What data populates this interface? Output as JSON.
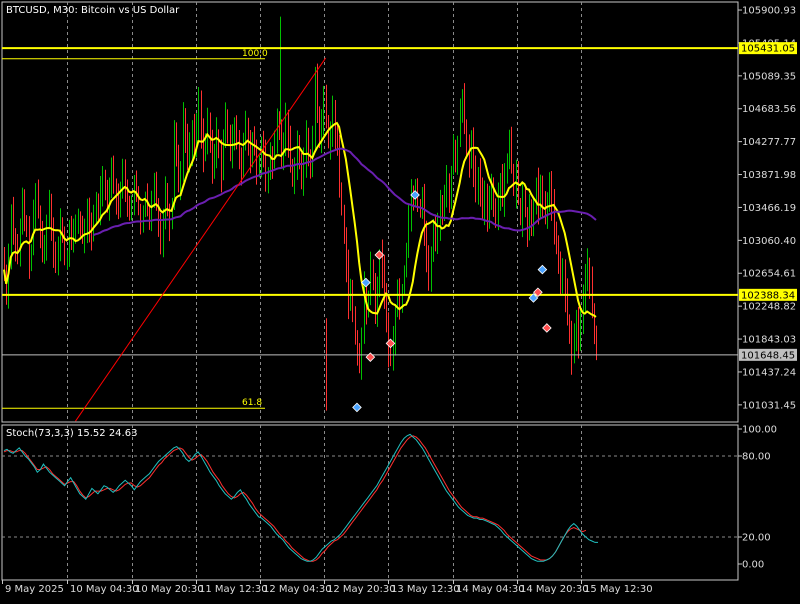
{
  "chart_data": [
    {
      "type": "candlestick",
      "title": "BTCUSD, M30:  Bitcoin vs US Dollar",
      "y_ticks": [
        "105900.93",
        "105495.14",
        "105089.35",
        "104683.56",
        "104277.77",
        "103871.98",
        "103466.19",
        "103060.40",
        "102654.61",
        "102248.82",
        "101843.03",
        "101437.24",
        "101031.45"
      ],
      "ylim": [
        100820,
        106000
      ],
      "x_ticks": [
        "9 May 2025",
        "10 May 04:30",
        "10 May 20:30",
        "11 May 12:30",
        "12 May 04:30",
        "12 May 20:30",
        "13 May 12:30",
        "14 May 04:30",
        "14 May 20:30",
        "15 May 12:30"
      ],
      "horizontal_levels": [
        {
          "label": "105431.05",
          "value": 105431.05,
          "color": "#ffff00"
        },
        {
          "label": "102388.34",
          "value": 102388.34,
          "color": "#ffff00"
        },
        {
          "label": "101648.45",
          "value": 101648.45,
          "color": "#c0c0c0"
        }
      ],
      "fibonacci": {
        "levels": [
          {
            "label": "100.0",
            "value": 105300
          },
          {
            "label": "61.8",
            "value": 100990
          }
        ],
        "color": "#ffff00"
      },
      "trendline": {
        "from": {
          "bar": 32,
          "price": 100830
        },
        "to": {
          "bar": 144,
          "price": 105310
        },
        "color": "#ff0000"
      },
      "candle_colors": {
        "bull": "#00c000",
        "bear": "#ff3030"
      },
      "closes": [
        102700,
        102350,
        102900,
        103450,
        103120,
        102980,
        102820,
        103200,
        103550,
        103300,
        103150,
        102800,
        102950,
        103350,
        103650,
        103420,
        103180,
        102870,
        102990,
        103310,
        103580,
        103260,
        102920,
        102740,
        102960,
        103280,
        103110,
        102810,
        102890,
        103150,
        103040,
        103210,
        103260,
        103330,
        103190,
        103080,
        103240,
        103380,
        103230,
        103090,
        103360,
        103560,
        103420,
        103690,
        103890,
        103660,
        103520,
        103780,
        103960,
        103760,
        103560,
        103410,
        103740,
        103900,
        103730,
        103540,
        103350,
        103560,
        103730,
        103600,
        103420,
        103260,
        103440,
        103580,
        103420,
        103230,
        103520,
        103780,
        103540,
        103280,
        103060,
        103350,
        103680,
        103460,
        103250,
        103530,
        104470,
        104120,
        103760,
        103900,
        104630,
        104340,
        104060,
        104190,
        104420,
        104250,
        104500,
        104770,
        104410,
        104090,
        104260,
        104480,
        104250,
        103940,
        104120,
        104380,
        104180,
        103870,
        104270,
        104600,
        104390,
        104080,
        104280,
        104530,
        104340,
        104110,
        103940,
        104240,
        104470,
        104220,
        104030,
        104340,
        104190,
        103880,
        104010,
        104290,
        104100,
        103720,
        103850,
        104160,
        103990,
        104220,
        104550,
        104380,
        104080,
        104310,
        104560,
        104290,
        104010,
        103800,
        104020,
        104270,
        104040,
        103760,
        104000,
        104360,
        104120,
        103990,
        104260,
        105100,
        104650,
        104310,
        104490,
        104830,
        104550,
        104260,
        104420,
        104670,
        104380,
        104160,
        103690,
        103450,
        103120,
        102760,
        102240,
        102450,
        102120,
        101870,
        101650,
        101500,
        101840,
        102550,
        102150,
        102320,
        102770,
        102540,
        102190,
        102400,
        102880,
        102690,
        102390,
        102130,
        101590,
        101560,
        101850,
        102180,
        102430,
        102250,
        102480,
        102690,
        102980,
        103380,
        103680,
        103530,
        103760,
        103510,
        103440,
        103660,
        103180,
        102800,
        102600,
        102880,
        103200,
        103010,
        103250,
        103560,
        103380,
        103630,
        103810,
        103570,
        103920,
        104190,
        103990,
        104310,
        104640,
        104880,
        104510,
        104250,
        104000,
        104240,
        103900,
        103610,
        103870,
        103640,
        103430,
        103690,
        103350,
        103590,
        103780,
        103470,
        103270,
        103640,
        103850,
        103560,
        103930,
        104050,
        104270,
        103940,
        103650,
        103880,
        103540,
        103320,
        103670,
        103390,
        103120,
        103480,
        103240,
        103520,
        103790,
        103420,
        103660,
        103500,
        103300,
        103590,
        103770,
        103480,
        103210,
        102960,
        102740,
        102490,
        102730,
        102380,
        102050,
        101880,
        101620,
        101860,
        102100,
        101790,
        102080,
        102330,
        102580,
        102800,
        102520,
        102160,
        101900,
        101650
      ]
    },
    {
      "type": "line",
      "title": "Stoch(73,3,3) 15.52 24.63",
      "y_ticks": [
        "100.00",
        "80.00",
        "20.00",
        "0.00"
      ],
      "ylim": [
        0,
        100
      ],
      "levels": [
        80,
        20
      ],
      "main_color": "#20c0c0",
      "signal_color": "#ff3030",
      "main": [
        84,
        85,
        83,
        82,
        84,
        86,
        83,
        80,
        78,
        75,
        72,
        68,
        70,
        74,
        71,
        68,
        66,
        64,
        62,
        60,
        58,
        61,
        64,
        60,
        56,
        52,
        50,
        48,
        52,
        56,
        54,
        52,
        55,
        58,
        57,
        55,
        53,
        55,
        58,
        60,
        62,
        60,
        58,
        55,
        58,
        61,
        63,
        65,
        67,
        70,
        73,
        76,
        78,
        80,
        82,
        84,
        86,
        87,
        85,
        82,
        78,
        76,
        78,
        81,
        83,
        80,
        76,
        72,
        68,
        65,
        62,
        58,
        55,
        52,
        50,
        48,
        50,
        53,
        55,
        51,
        48,
        44,
        41,
        38,
        35,
        34,
        32,
        30,
        28,
        25,
        22,
        20,
        18,
        15,
        12,
        10,
        8,
        6,
        4,
        3,
        2,
        2,
        3,
        5,
        8,
        11,
        13,
        15,
        17,
        18,
        20,
        22,
        25,
        28,
        31,
        34,
        37,
        40,
        43,
        46,
        49,
        52,
        55,
        58,
        62,
        66,
        70,
        74,
        78,
        82,
        86,
        90,
        93,
        95,
        96,
        94,
        92,
        89,
        86,
        82,
        78,
        74,
        70,
        66,
        62,
        58,
        54,
        51,
        48,
        45,
        42,
        40,
        38,
        36,
        35,
        34,
        34,
        33,
        33,
        32,
        31,
        30,
        29,
        27,
        25,
        22,
        20,
        18,
        16,
        14,
        12,
        10,
        8,
        6,
        4,
        3,
        2,
        2,
        2,
        3,
        4,
        6,
        9,
        13,
        17,
        21,
        25,
        28,
        30,
        28,
        25,
        22,
        20,
        18,
        17,
        16,
        16
      ],
      "signal": [
        83,
        84,
        84,
        83,
        83,
        84,
        84,
        82,
        79,
        76,
        73,
        70,
        70,
        71,
        72,
        70,
        67,
        65,
        63,
        61,
        59,
        60,
        61,
        61,
        58,
        54,
        51,
        49,
        50,
        52,
        54,
        54,
        54,
        55,
        56,
        56,
        55,
        54,
        55,
        57,
        59,
        60,
        60,
        58,
        57,
        58,
        60,
        62,
        64,
        67,
        70,
        73,
        75,
        78,
        80,
        82,
        84,
        85,
        86,
        85,
        82,
        79,
        77,
        78,
        80,
        81,
        79,
        76,
        72,
        68,
        65,
        62,
        58,
        55,
        52,
        50,
        49,
        50,
        52,
        53,
        51,
        48,
        45,
        41,
        38,
        36,
        34,
        32,
        30,
        28,
        25,
        22,
        20,
        17,
        15,
        12,
        10,
        8,
        6,
        4,
        3,
        2,
        2,
        3,
        5,
        8,
        10,
        13,
        15,
        17,
        18,
        20,
        22,
        25,
        28,
        31,
        34,
        37,
        40,
        43,
        46,
        49,
        52,
        55,
        59,
        62,
        66,
        70,
        74,
        78,
        82,
        86,
        89,
        92,
        94,
        95,
        94,
        92,
        89,
        86,
        82,
        78,
        74,
        70,
        66,
        62,
        58,
        54,
        51,
        48,
        45,
        42,
        40,
        38,
        36,
        35,
        35,
        34,
        34,
        33,
        32,
        31,
        30,
        29,
        27,
        25,
        22,
        20,
        18,
        16,
        14,
        12,
        10,
        8,
        6,
        5,
        4,
        3,
        3,
        3,
        4,
        6,
        9,
        13,
        17,
        21,
        24,
        26,
        27,
        26,
        25,
        24,
        25
      ]
    }
  ]
}
